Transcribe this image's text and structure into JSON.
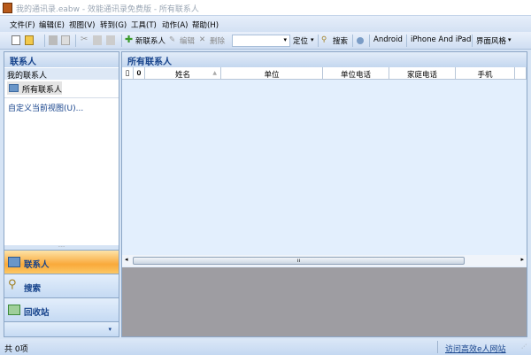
{
  "window": {
    "title": "我的通讯录.eabw - 效能通讯录免费版 - 所有联系人"
  },
  "menu": [
    "文件(F)",
    "编辑(E)",
    "视图(V)",
    "转到(G)",
    "工具(T)",
    "动作(A)",
    "帮助(H)"
  ],
  "toolbar": {
    "new_contact": "新联系人",
    "edit": "编辑",
    "delete": "删除",
    "search_value": "",
    "locate": "定位",
    "search": "搜索",
    "android": "Android",
    "iphone": "iPhone And iPad",
    "skin": "界面风格"
  },
  "sidebar": {
    "title": "联系人",
    "group": "我的联系人",
    "item": "所有联系人",
    "customize": "自定义当前视图(U)...",
    "nav": [
      {
        "label": "联系人",
        "icon": "contacts-icon",
        "active": true
      },
      {
        "label": "搜索",
        "icon": "search-icon"
      },
      {
        "label": "回收站",
        "icon": "recycle-bin-icon"
      }
    ]
  },
  "main": {
    "title": "所有联系人",
    "columns": [
      "姓名",
      "单位",
      "单位电话",
      "家庭电话",
      "手机"
    ]
  },
  "status": {
    "count": "共 0项",
    "link": "访问高效e人网站"
  },
  "colors": {
    "active_nav": "#f9a93a",
    "accent": "#15428b"
  }
}
